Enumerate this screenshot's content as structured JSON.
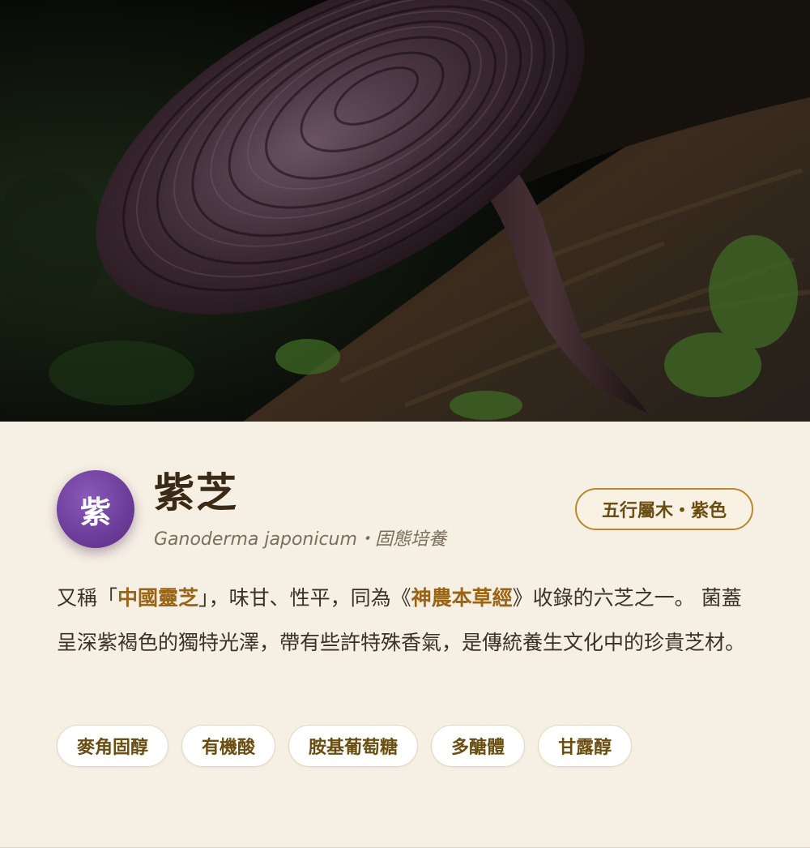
{
  "hero": {
    "image": "ganoderma-mushroom-photo"
  },
  "species": {
    "avatar_char": "紫",
    "name": "紫芝",
    "latin_name": "Ganoderma japonicum",
    "separator": "・",
    "cultivation": "固態培養",
    "element_badge": "五行屬木・紫色"
  },
  "description": {
    "p1": "又稱",
    "q_open": "「",
    "hl1": "中國靈芝",
    "q_close": "」",
    "p2": "，味甘、性平，同為",
    "b_open": "《",
    "hl2": "神農本草經",
    "b_close": "》",
    "p3": "收錄的六芝之一。 菌蓋呈深紫褐色的獨特光澤，帶有些許特殊香氣，是傳統養生文化中的珍貴芝材。"
  },
  "tags": [
    {
      "label": "麥角固醇"
    },
    {
      "label": "有機酸"
    },
    {
      "label": "胺基葡萄糖"
    },
    {
      "label": "多醣體"
    },
    {
      "label": "甘露醇"
    }
  ],
  "colors": {
    "accent": "#9a6414",
    "avatar": "#6e3f9c",
    "background": "#f6efe3",
    "badge_border": "#b8892f"
  }
}
